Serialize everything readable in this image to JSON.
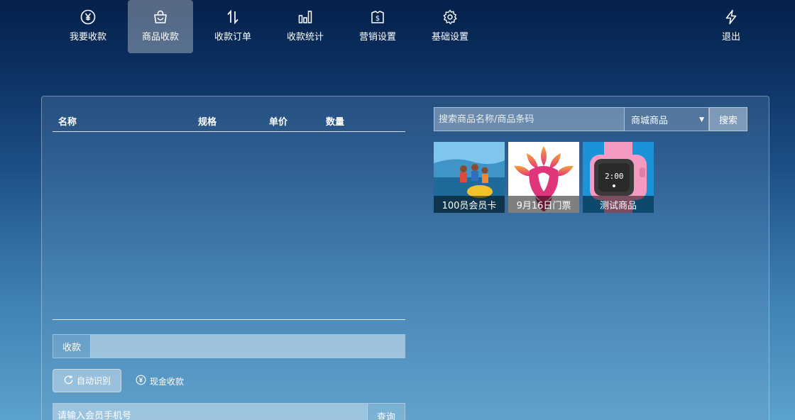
{
  "nav": {
    "items": [
      {
        "label": "我要收款",
        "icon": "yen-circle-icon"
      },
      {
        "label": "商品收款",
        "icon": "shopping-bag-icon"
      },
      {
        "label": "收款订单",
        "icon": "sort-arrows-icon"
      },
      {
        "label": "收款统计",
        "icon": "bar-chart-icon"
      },
      {
        "label": "营销设置",
        "icon": "marketing-icon"
      },
      {
        "label": "基础设置",
        "icon": "gear-icon"
      },
      {
        "label": "退出",
        "icon": "lightning-icon"
      }
    ],
    "active_index": 1
  },
  "cart": {
    "headers": [
      "名称",
      "规格",
      "单价",
      "数量"
    ]
  },
  "payment": {
    "label": "收款",
    "value": "",
    "auto_detect_label": "自动识别",
    "cash_label": "现金收款"
  },
  "member": {
    "placeholder": "请输入会员手机号",
    "query_label": "查询"
  },
  "search": {
    "placeholder": "搜索商品名称/商品条码",
    "category_selected": "商城商品",
    "button_label": "搜索"
  },
  "products": [
    {
      "name": "100员会员卡"
    },
    {
      "name": "9月16日门票"
    },
    {
      "name": "测试商品"
    }
  ],
  "colors": {
    "background_top": "#05204a",
    "background_bottom": "#5aa3cc",
    "active_nav": "#6f8aa6"
  }
}
